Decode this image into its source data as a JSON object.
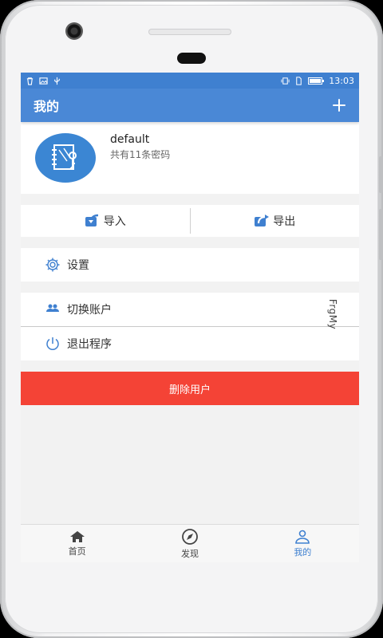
{
  "statusbar": {
    "time": "13:03"
  },
  "appbar": {
    "title": "我的"
  },
  "profile": {
    "name": "default",
    "password_count": "共有11条密码"
  },
  "actions": {
    "import_label": "导入",
    "export_label": "导出"
  },
  "menu": {
    "settings_label": "设置",
    "switch_account_label": "切换账户",
    "exit_label": "退出程序"
  },
  "overlay_text": "FrgMy",
  "danger_button_label": "删除用户",
  "bottom_nav": [
    {
      "label": "首页",
      "icon": "home-icon"
    },
    {
      "label": "发现",
      "icon": "compass-icon"
    },
    {
      "label": "我的",
      "icon": "user-icon"
    }
  ],
  "colors": {
    "primary": "#4a88d6",
    "danger": "#f44336",
    "status_bar": "#3f80d0"
  }
}
